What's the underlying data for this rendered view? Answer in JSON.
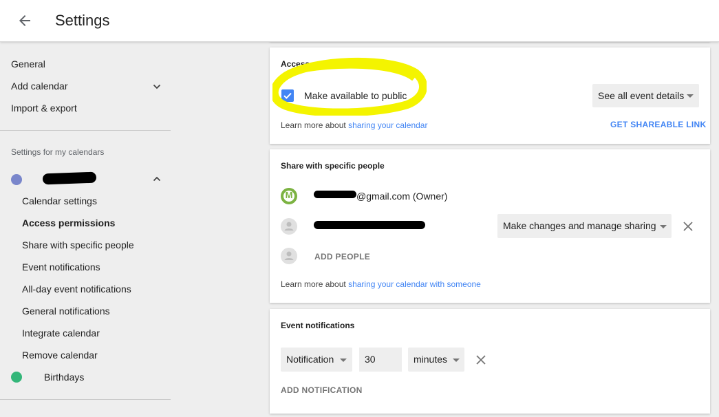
{
  "header": {
    "title": "Settings"
  },
  "sidebar": {
    "general": "General",
    "add_calendar": "Add calendar",
    "import_export": "Import & export",
    "section_label": "Settings for my calendars",
    "sub_items": [
      "Calendar settings",
      "Access permissions",
      "Share with specific people",
      "Event notifications",
      "All-day event notifications",
      "General notifications",
      "Integrate calendar",
      "Remove calendar"
    ],
    "birthdays": "Birthdays",
    "colors": {
      "my_calendar": "#7986cb",
      "birthdays": "#33b679"
    }
  },
  "access_permissions": {
    "title": "Access permissions",
    "checkbox_label": "Make available to public",
    "checked": true,
    "visibility_select": "See all event details",
    "learn_prefix": "Learn more about ",
    "learn_link": "sharing your calendar",
    "shareable_link_button": "GET SHAREABLE LINK"
  },
  "share": {
    "title": "Share with specific people",
    "owner_email_suffix": "@gmail.com (Owner)",
    "owner_avatar_letter": "M",
    "permission_select": "Make changes and manage sharing",
    "add_people": "ADD PEOPLE",
    "learn_prefix": "Learn more about ",
    "learn_link": "sharing your calendar with someone"
  },
  "event_notifications": {
    "title": "Event notifications",
    "type_select": "Notification",
    "amount": "30",
    "unit_select": "minutes",
    "add_notification": "ADD NOTIFICATION"
  }
}
